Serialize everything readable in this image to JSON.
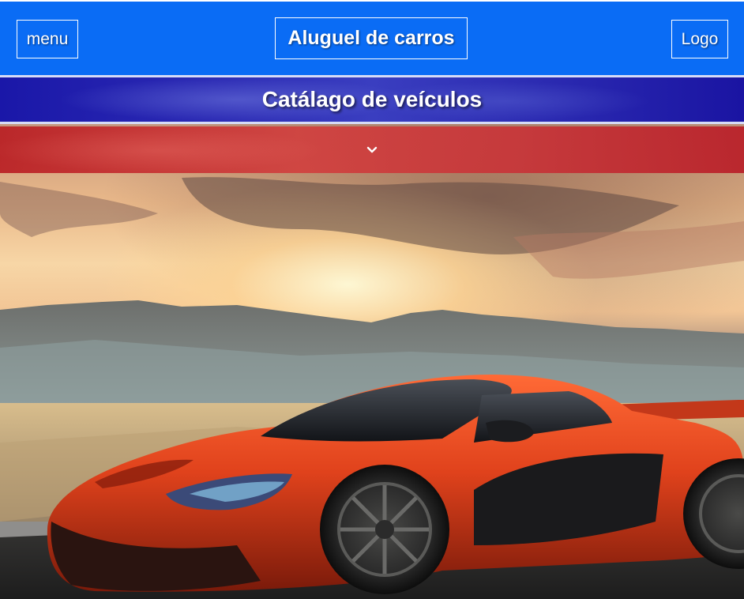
{
  "header": {
    "menu_label": "menu",
    "title": "Aluguel de carros",
    "logo_label": "Logo"
  },
  "catalog": {
    "title": "Catálago de veículos"
  },
  "expand": {
    "icon": "chevron-down-icon"
  },
  "colors": {
    "nav_blue": "#0a6cf5",
    "catalog_band": "#2a29b0",
    "expand_band": "#c8323a",
    "car_orange": "#e0421c"
  }
}
